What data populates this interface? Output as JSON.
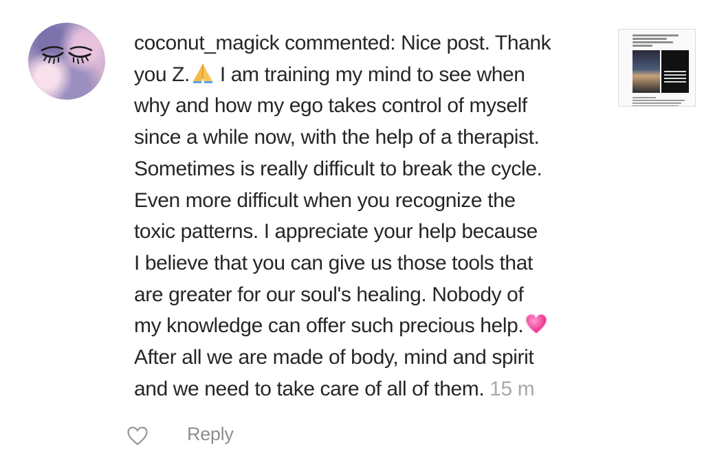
{
  "comment": {
    "lines": [
      "coconut_magick commented: Nice post. Thank",
      "you Z.",
      " I am training my mind to see when",
      "why and how my ego takes control of myself",
      "since a while now, with the help of a therapist.",
      "Sometimes is really difficult to break the cycle.",
      "Even more difficult when you recognize the",
      "toxic patterns. I appreciate your help because",
      "I believe that you can give us those tools that",
      "are greater for our soul's healing. Nobody of",
      "my knowledge can offer such precious help.",
      "After all we are made of body, mind and spirit",
      "and we need to take care of all of them."
    ],
    "time": "15 m"
  },
  "actions": {
    "reply_label": "Reply"
  },
  "icons": {
    "like": "heart-icon",
    "prayer": "folded-hands-emoji",
    "heart": "pink-heart-emoji"
  },
  "colors": {
    "text": "#262626",
    "muted": "#8e8e8e",
    "time": "#a8a8a8"
  }
}
